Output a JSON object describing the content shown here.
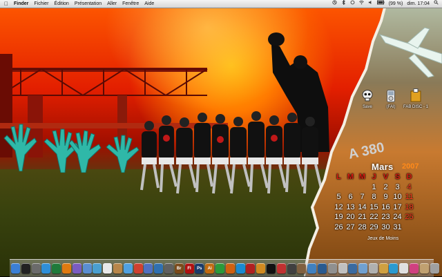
{
  "menubar": {
    "app": "Finder",
    "menus": [
      "Fichier",
      "Édition",
      "Présentation",
      "Aller",
      "Fenêtre",
      "Aide"
    ],
    "battery": "(99 %)",
    "clock": "dim. 17:04"
  },
  "desktop_icons": [
    {
      "label": "Save",
      "icon": "skull-drive-icon"
    },
    {
      "label": "(FAI)",
      "icon": "ipod-icon"
    },
    {
      "label": "FAB DISC - 1",
      "icon": "disc-image-icon"
    }
  ],
  "calendar": {
    "month": "Mars",
    "year": "2007",
    "weekdays": [
      "L",
      "M",
      "M",
      "J",
      "V",
      "S",
      "D"
    ],
    "rows": [
      [
        "",
        "",
        "",
        "1",
        "2",
        "3",
        "4"
      ],
      [
        "5",
        "6",
        "7",
        "8",
        "9",
        "10",
        "11"
      ],
      [
        "12",
        "13",
        "14",
        "15",
        "16",
        "17",
        "18"
      ],
      [
        "19",
        "20",
        "21",
        "22",
        "23",
        "24",
        "25"
      ],
      [
        "26",
        "27",
        "28",
        "29",
        "30",
        "31",
        ""
      ]
    ],
    "footer": "Jeux de Moins"
  },
  "colors": {
    "calendar_header": "#d81b10",
    "accent_orange": "#ff8a1a"
  },
  "dock": {
    "items": [
      {
        "icon": "finder-icon",
        "color": "#3b7fd6"
      },
      {
        "icon": "dashboard-icon",
        "color": "#222"
      },
      {
        "icon": "system-prefs-icon",
        "color": "#6b6b6b"
      },
      {
        "icon": "safari-icon",
        "color": "#2f8fd8"
      },
      {
        "icon": "itunes-icon",
        "color": "#1f7a3a"
      },
      {
        "icon": "vlc-icon",
        "color": "#e07a10"
      },
      {
        "icon": "app-icon",
        "color": "#7a5cc2"
      },
      {
        "icon": "mail-icon",
        "color": "#5a8ed0"
      },
      {
        "icon": "preview-icon",
        "color": "#4a9fd0"
      },
      {
        "icon": "textedit-icon",
        "color": "#e8e8e8"
      },
      {
        "icon": "address-book-icon",
        "color": "#b8864a"
      },
      {
        "icon": "photo-icon",
        "color": "#50a0e0"
      },
      {
        "icon": "ical-icon",
        "color": "#d04030"
      },
      {
        "icon": "iphoto-icon",
        "color": "#5070c0"
      },
      {
        "icon": "imovie-icon",
        "color": "#3070b0"
      },
      {
        "icon": "idvd-icon",
        "color": "#606060"
      },
      {
        "icon": "bridge-icon",
        "label": "Br",
        "color": "#7a4a1a"
      },
      {
        "icon": "flash-icon",
        "label": "Fl",
        "color": "#b01010"
      },
      {
        "icon": "photoshop-icon",
        "label": "Ps",
        "color": "#1a3a6a"
      },
      {
        "icon": "illustrator-icon",
        "label": "Ai",
        "color": "#c06a10"
      },
      {
        "icon": "messenger-icon",
        "color": "#2a9a3a"
      },
      {
        "icon": "firefox-icon",
        "color": "#d06010"
      },
      {
        "icon": "skype-icon",
        "color": "#1a8ad0"
      },
      {
        "icon": "photo-booth-icon",
        "color": "#b02020"
      },
      {
        "icon": "garageband-icon",
        "color": "#d08a20"
      },
      {
        "icon": "terminal-icon",
        "color": "#111"
      },
      {
        "icon": "toast-icon",
        "color": "#c03030"
      },
      {
        "icon": "app-icon",
        "color": "#404040"
      },
      {
        "icon": "chess-icon",
        "color": "#806040"
      },
      {
        "icon": "network-icon",
        "color": "#4080c0"
      },
      {
        "icon": "time-icon",
        "color": "#2a5a90"
      },
      {
        "icon": "app-icon",
        "color": "#909090"
      },
      {
        "icon": "app-icon",
        "color": "#c0c0c0"
      },
      {
        "icon": "app-icon",
        "color": "#3a6aa0"
      },
      {
        "icon": "app-icon",
        "color": "#70a0d0"
      },
      {
        "icon": "folder-icon",
        "color": "#b0b0b0"
      },
      {
        "icon": "app-icon",
        "color": "#d0a040"
      },
      {
        "icon": "app-icon",
        "color": "#2a9ad0"
      },
      {
        "icon": "app-icon",
        "color": "#e0e0e0"
      },
      {
        "icon": "app-icon",
        "color": "#d04080"
      },
      {
        "icon": "app-icon",
        "color": "#c0a070"
      },
      {
        "icon": "app-icon",
        "color": "#a0a0a0"
      }
    ],
    "trailing": [
      {
        "icon": "downloads-stack-icon",
        "color": "#90a0b0"
      },
      {
        "icon": "trash-icon",
        "color": "#b0b0b0"
      }
    ]
  }
}
